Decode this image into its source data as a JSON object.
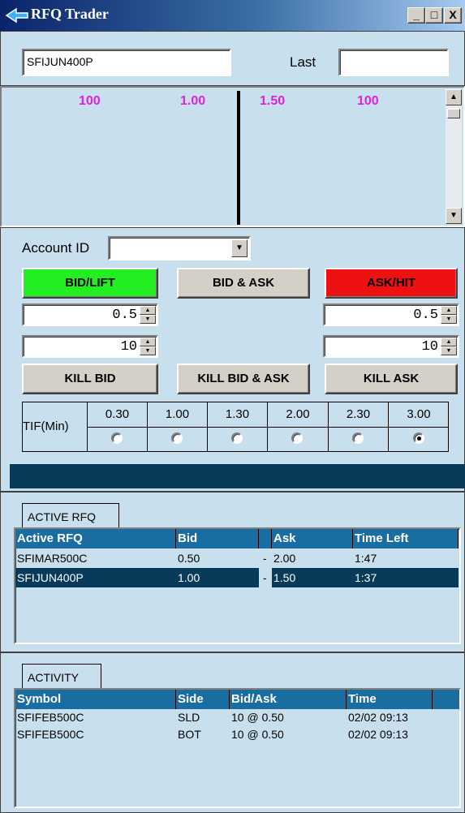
{
  "window": {
    "title": "RFQ Trader",
    "buttons": {
      "minimize": "_",
      "maximize": "□",
      "close": "X"
    }
  },
  "header": {
    "symbol_value": "SFIJUN400P",
    "last_label": "Last",
    "last_value": ""
  },
  "depth": {
    "bid_size": "100",
    "bid_price": "1.00",
    "ask_price": "1.50",
    "ask_size": "100",
    "bid_ask_color": "#e020e0"
  },
  "order_entry": {
    "account_label": "Account ID",
    "account_value": "",
    "bid_lift_label": "BID/LIFT",
    "bid_ask_label": "BID & ASK",
    "ask_hit_label": "ASK/HIT",
    "bid_price": "0.5",
    "bid_qty": "10",
    "ask_price": "0.5",
    "ask_qty": "10",
    "kill_bid_label": "KILL BID",
    "kill_both_label": "KILL BID & ASK",
    "kill_ask_label": "KILL ASK",
    "colors": {
      "bid_lift": "#22ee22",
      "ask_hit": "#ee1111"
    }
  },
  "tif": {
    "label": "TIF(Min)",
    "options": [
      "0.30",
      "1.00",
      "1.30",
      "2.00",
      "2.30",
      "3.00"
    ],
    "selected": "3.00"
  },
  "active_rfq": {
    "tab_label": "ACTIVE RFQ",
    "columns": [
      "Active RFQ",
      "Bid",
      "",
      "Ask",
      "Time Left"
    ],
    "rows": [
      {
        "symbol": "SFIMAR500C",
        "bid": "0.50",
        "sep": "-",
        "ask": "2.00",
        "time_left": "1:47",
        "selected": false
      },
      {
        "symbol": "SFIJUN400P",
        "bid": "1.00",
        "sep": "-",
        "ask": "1.50",
        "time_left": "1:37",
        "selected": true
      }
    ]
  },
  "activity": {
    "tab_label": "ACTIVITY",
    "columns": [
      "Symbol",
      "Side",
      "Bid/Ask",
      "Time"
    ],
    "rows": [
      {
        "symbol": "SFIFEB500C",
        "side": "SLD",
        "bid_ask": "10 @ 0.50",
        "time": "02/02 09:13"
      },
      {
        "symbol": "SFIFEB500C",
        "side": "BOT",
        "bid_ask": "10 @ 0.50",
        "time": "02/02 09:13"
      }
    ]
  }
}
